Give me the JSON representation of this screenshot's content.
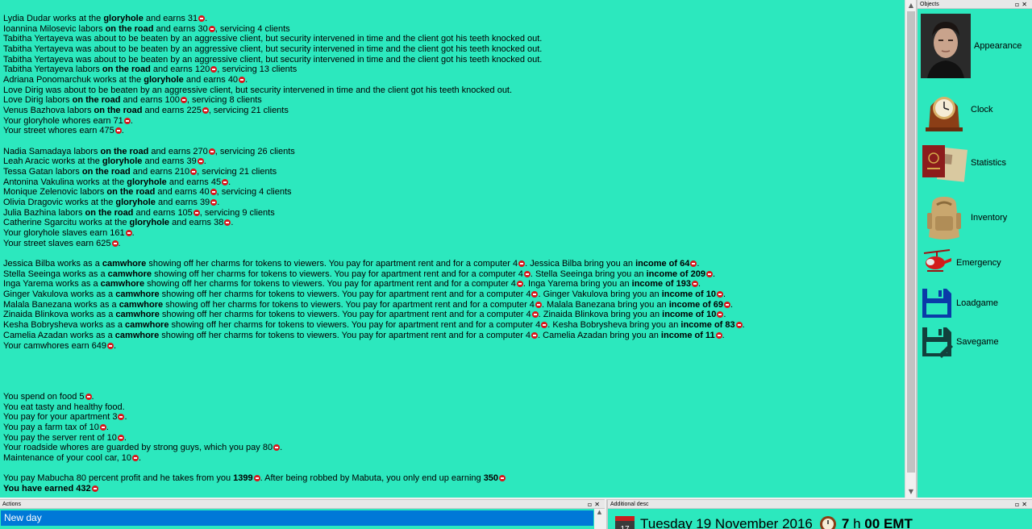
{
  "log": {
    "lines": [
      [
        {
          "t": "Lydia Dudar works at the "
        },
        {
          "t": "gloryhole",
          "b": 1
        },
        {
          "t": " and earns 31"
        },
        {
          "coin": 1
        },
        {
          "t": "."
        }
      ],
      [
        {
          "t": "Ioannina Milosevic labors "
        },
        {
          "t": "on the road",
          "b": 1
        },
        {
          "t": " and earns 30"
        },
        {
          "coin": 1
        },
        {
          "t": ", servicing 4 clients"
        }
      ],
      [
        {
          "t": "Tabitha Yertayeva was about to be beaten by an aggressive client, but security intervened in time and the client got his teeth knocked out."
        }
      ],
      [
        {
          "t": "Tabitha Yertayeva was about to be beaten by an aggressive client, but security intervened in time and the client got his teeth knocked out."
        }
      ],
      [
        {
          "t": "Tabitha Yertayeva was about to be beaten by an aggressive client, but security intervened in time and the client got his teeth knocked out."
        }
      ],
      [
        {
          "t": "Tabitha Yertayeva labors "
        },
        {
          "t": "on the road",
          "b": 1
        },
        {
          "t": " and earns 120"
        },
        {
          "coin": 1
        },
        {
          "t": ", servicing 13 clients"
        }
      ],
      [
        {
          "t": "Adriana Ponomarchuk works at the "
        },
        {
          "t": "gloryhole",
          "b": 1
        },
        {
          "t": " and earns 40"
        },
        {
          "coin": 1
        },
        {
          "t": "."
        }
      ],
      [
        {
          "t": "Love Dirig was about to be beaten by an aggressive client, but security intervened in time and the client got his teeth knocked out."
        }
      ],
      [
        {
          "t": "Love Dirig labors "
        },
        {
          "t": "on the road",
          "b": 1
        },
        {
          "t": " and earns 100"
        },
        {
          "coin": 1
        },
        {
          "t": ", servicing 8 clients"
        }
      ],
      [
        {
          "t": "Venus Bazhova labors "
        },
        {
          "t": "on the road",
          "b": 1
        },
        {
          "t": " and earns 225"
        },
        {
          "coin": 1
        },
        {
          "t": ", servicing 21 clients"
        }
      ],
      [
        {
          "t": "Your gloryhole whores earn 71"
        },
        {
          "coin": 1
        },
        {
          "t": "."
        }
      ],
      [
        {
          "t": "Your street whores earn 475"
        },
        {
          "coin": 1
        },
        {
          "t": "."
        }
      ],
      [],
      [
        {
          "t": "Nadia Samadaya labors "
        },
        {
          "t": "on the road",
          "b": 1
        },
        {
          "t": " and earns 270"
        },
        {
          "coin": 1
        },
        {
          "t": ", servicing 26 clients"
        }
      ],
      [
        {
          "t": "Leah Aracic works at the "
        },
        {
          "t": "gloryhole",
          "b": 1
        },
        {
          "t": " and earns 39"
        },
        {
          "coin": 1
        },
        {
          "t": "."
        }
      ],
      [
        {
          "t": "Tessa Gatan labors "
        },
        {
          "t": "on the road",
          "b": 1
        },
        {
          "t": " and earns 210"
        },
        {
          "coin": 1
        },
        {
          "t": ", servicing 21 clients"
        }
      ],
      [
        {
          "t": "Antonina Vakulina works at the "
        },
        {
          "t": "gloryhole",
          "b": 1
        },
        {
          "t": " and earns 45"
        },
        {
          "coin": 1
        },
        {
          "t": "."
        }
      ],
      [
        {
          "t": "Monique Zelenovic labors "
        },
        {
          "t": "on the road",
          "b": 1
        },
        {
          "t": " and earns 40"
        },
        {
          "coin": 1
        },
        {
          "t": ", servicing 4 clients"
        }
      ],
      [
        {
          "t": "Olivia Dragovic works at the "
        },
        {
          "t": "gloryhole",
          "b": 1
        },
        {
          "t": " and earns 39"
        },
        {
          "coin": 1
        },
        {
          "t": "."
        }
      ],
      [
        {
          "t": "Julia Bazhina labors "
        },
        {
          "t": "on the road",
          "b": 1
        },
        {
          "t": " and earns 105"
        },
        {
          "coin": 1
        },
        {
          "t": ", servicing 9 clients"
        }
      ],
      [
        {
          "t": "Catherine Sgarcitu works at the "
        },
        {
          "t": "gloryhole",
          "b": 1
        },
        {
          "t": " and earns 38"
        },
        {
          "coin": 1
        },
        {
          "t": "."
        }
      ],
      [
        {
          "t": "Your gloryhole slaves earn 161"
        },
        {
          "coin": 1
        },
        {
          "t": "."
        }
      ],
      [
        {
          "t": "Your street slaves earn 625"
        },
        {
          "coin": 1
        },
        {
          "t": "."
        }
      ],
      [],
      [
        {
          "t": "Jessica Bilba works as a "
        },
        {
          "t": "camwhore",
          "b": 1
        },
        {
          "t": " showing off her charms for tokens to viewers. You pay for apartment rent and for a computer 4"
        },
        {
          "coin": 1
        },
        {
          "t": ". Jessica Bilba bring you an "
        },
        {
          "t": "income of 64",
          "b": 1
        },
        {
          "coin": 1
        },
        {
          "t": "."
        }
      ],
      [
        {
          "t": "Stella Seeinga works as a "
        },
        {
          "t": "camwhore",
          "b": 1
        },
        {
          "t": " showing off her charms for tokens to viewers. You pay for apartment rent and for a computer 4"
        },
        {
          "coin": 1
        },
        {
          "t": ". Stella Seeinga bring you an "
        },
        {
          "t": "income of 209",
          "b": 1
        },
        {
          "coin": 1
        },
        {
          "t": "."
        }
      ],
      [
        {
          "t": "Inga Yarema works as a "
        },
        {
          "t": "camwhore",
          "b": 1
        },
        {
          "t": " showing off her charms for tokens to viewers. You pay for apartment rent and for a computer 4"
        },
        {
          "coin": 1
        },
        {
          "t": ". Inga Yarema bring you an "
        },
        {
          "t": "income of 193",
          "b": 1
        },
        {
          "coin": 1
        },
        {
          "t": "."
        }
      ],
      [
        {
          "t": "Ginger Vakulova works as a "
        },
        {
          "t": "camwhore",
          "b": 1
        },
        {
          "t": " showing off her charms for tokens to viewers. You pay for apartment rent and for a computer 4"
        },
        {
          "coin": 1
        },
        {
          "t": ". Ginger Vakulova bring you an "
        },
        {
          "t": "income of 10",
          "b": 1
        },
        {
          "coin": 1
        },
        {
          "t": "."
        }
      ],
      [
        {
          "t": "Malala Banezana works as a "
        },
        {
          "t": "camwhore",
          "b": 1
        },
        {
          "t": " showing off her charms for tokens to viewers. You pay for apartment rent and for a computer 4"
        },
        {
          "coin": 1
        },
        {
          "t": ". Malala Banezana bring you an "
        },
        {
          "t": "income of 69",
          "b": 1
        },
        {
          "coin": 1
        },
        {
          "t": "."
        }
      ],
      [
        {
          "t": "Zinaida Blinkova works as a "
        },
        {
          "t": "camwhore",
          "b": 1
        },
        {
          "t": " showing off her charms for tokens to viewers. You pay for apartment rent and for a computer 4"
        },
        {
          "coin": 1
        },
        {
          "t": ". Zinaida Blinkova bring you an "
        },
        {
          "t": "income of 10",
          "b": 1
        },
        {
          "coin": 1
        },
        {
          "t": "."
        }
      ],
      [
        {
          "t": "Kesha Bobrysheva works as a "
        },
        {
          "t": "camwhore",
          "b": 1
        },
        {
          "t": " showing off her charms for tokens to viewers. You pay for apartment rent and for a computer 4"
        },
        {
          "coin": 1
        },
        {
          "t": ". Kesha Bobrysheva bring you an "
        },
        {
          "t": "income of 83",
          "b": 1
        },
        {
          "coin": 1
        },
        {
          "t": "."
        }
      ],
      [
        {
          "t": "Camelia Azadan works as a "
        },
        {
          "t": "camwhore",
          "b": 1
        },
        {
          "t": " showing off her charms for tokens to viewers. You pay for apartment rent and for a computer 4"
        },
        {
          "coin": 1
        },
        {
          "t": ". Camelia Azadan bring you an "
        },
        {
          "t": "income of 11",
          "b": 1
        },
        {
          "coin": 1
        },
        {
          "t": "."
        }
      ],
      [
        {
          "t": "Your camwhores earn 649"
        },
        {
          "coin": 1
        },
        {
          "t": "."
        }
      ],
      [],
      [],
      [],
      [],
      [
        {
          "t": "You spend on food 5"
        },
        {
          "coin": 1
        },
        {
          "t": "."
        }
      ],
      [
        {
          "t": "You eat tasty and healthy food."
        }
      ],
      [
        {
          "t": "You pay for your apartment 3"
        },
        {
          "coin": 1
        },
        {
          "t": "."
        }
      ],
      [
        {
          "t": "You pay a farm tax of 10"
        },
        {
          "coin": 1
        },
        {
          "t": "."
        }
      ],
      [
        {
          "t": "You pay the server rent of 10"
        },
        {
          "coin": 1
        },
        {
          "t": "."
        }
      ],
      [
        {
          "t": "Your roadside whores are guarded by strong guys, which you pay 80"
        },
        {
          "coin": 1
        },
        {
          "t": "."
        }
      ],
      [
        {
          "t": "Maintenance of your cool car, 10"
        },
        {
          "coin": 1
        },
        {
          "t": "."
        }
      ],
      [],
      [
        {
          "t": "You pay Mabucha 80 percent profit and he takes from you "
        },
        {
          "t": "1399",
          "b": 1
        },
        {
          "coin": 1
        },
        {
          "t": ". After being robbed by Mabuta, you only end up earning "
        },
        {
          "t": "350",
          "b": 1
        },
        {
          "coin": 1
        }
      ],
      [
        {
          "t": "You have earned 432",
          "b": 1
        },
        {
          "coin": 1
        }
      ]
    ]
  },
  "objects": {
    "title": "Objects",
    "items": [
      {
        "label": "Appearance",
        "icon": "portrait-icon"
      },
      {
        "label": "Clock",
        "icon": "clock-icon"
      },
      {
        "label": "Statistics",
        "icon": "passport-icon"
      },
      {
        "label": "Inventory",
        "icon": "backpack-icon"
      },
      {
        "label": "Emergency",
        "icon": "helicopter-icon"
      },
      {
        "label": "Loadgame",
        "icon": "floppy-icon"
      },
      {
        "label": "Savegame",
        "icon": "floppy-edit-icon"
      }
    ]
  },
  "actions": {
    "title": "Actions",
    "selected": "New day"
  },
  "additional": {
    "title": "Additional desc",
    "date": "Tuesday 19 November 2016",
    "hour": "7",
    "h_label": "h",
    "minutes": "00",
    "zone": "EMT",
    "calendar_day": "17"
  },
  "colors": {
    "background": "#2ce8be",
    "selection": "#0078d7",
    "coin": "#d8161c"
  }
}
